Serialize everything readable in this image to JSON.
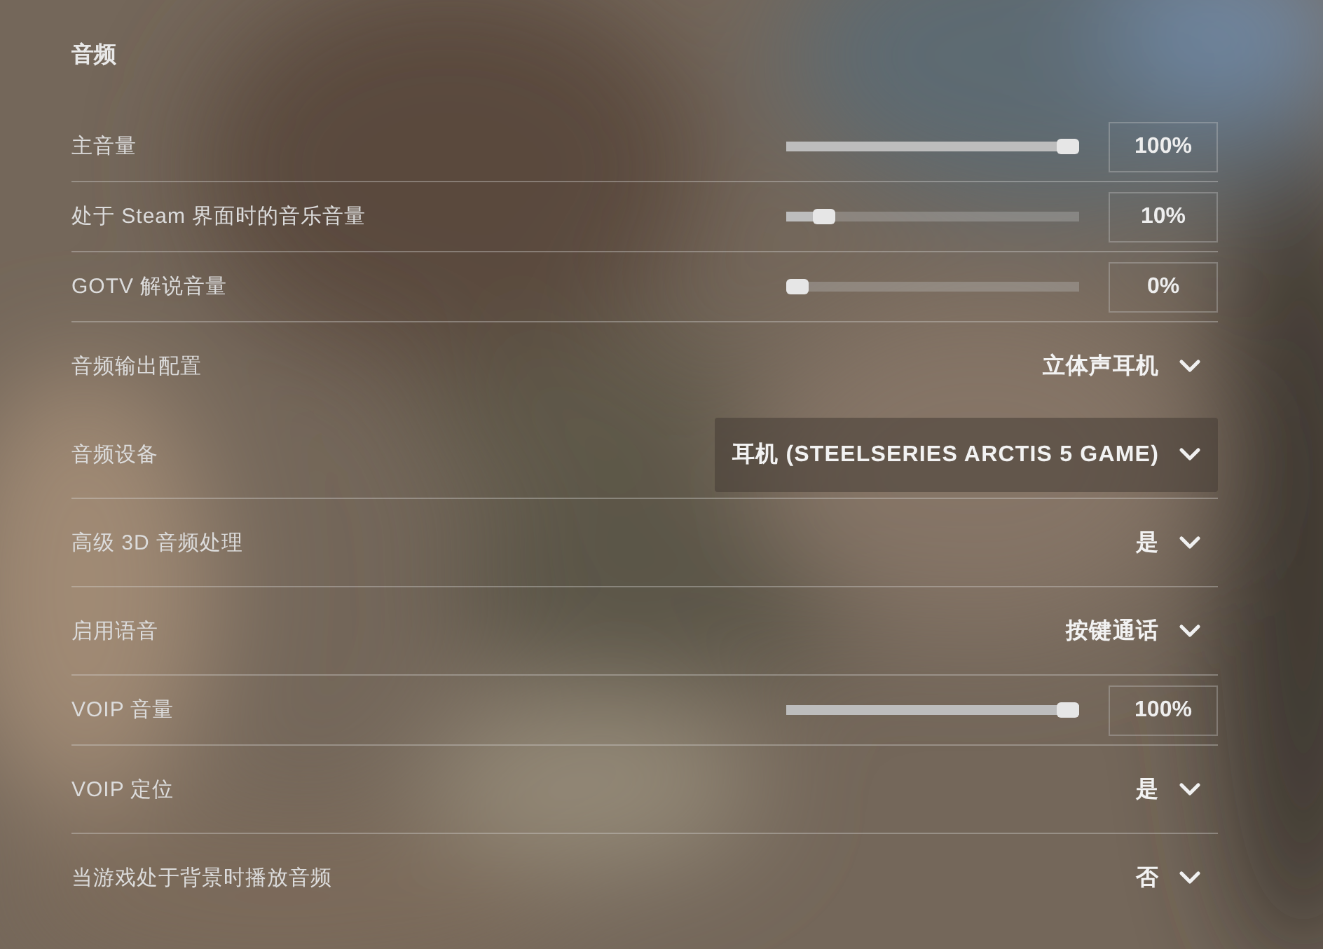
{
  "section_title": "音频",
  "settings": [
    {
      "kind": "slider",
      "label": "主音量",
      "level": 1.0,
      "reading": "100%"
    },
    {
      "kind": "slider",
      "label": "处于 Steam 界面时的音乐音量",
      "level": 0.1,
      "reading": "10%"
    },
    {
      "kind": "slider",
      "label": "GOTV 解说音量",
      "level": 0.0,
      "reading": "0%"
    },
    {
      "kind": "dropdown",
      "label": "音频输出配置",
      "value": "立体声耳机",
      "highlighted": false
    },
    {
      "kind": "dropdown",
      "label": "音频设备",
      "value": "耳机 (STEELSERIES ARCTIS 5 GAME)",
      "highlighted": true
    },
    {
      "kind": "dropdown",
      "label": "高级 3D 音频处理",
      "value": "是",
      "highlighted": false
    },
    {
      "kind": "dropdown",
      "label": "启用语音",
      "value": "按键通话",
      "highlighted": false
    },
    {
      "kind": "slider",
      "label": "VOIP 音量",
      "level": 1.0,
      "reading": "100%"
    },
    {
      "kind": "dropdown",
      "label": "VOIP 定位",
      "value": "是",
      "highlighted": false
    },
    {
      "kind": "dropdown",
      "label": "当游戏处于背景时播放音频",
      "value": "否",
      "highlighted": false
    }
  ]
}
